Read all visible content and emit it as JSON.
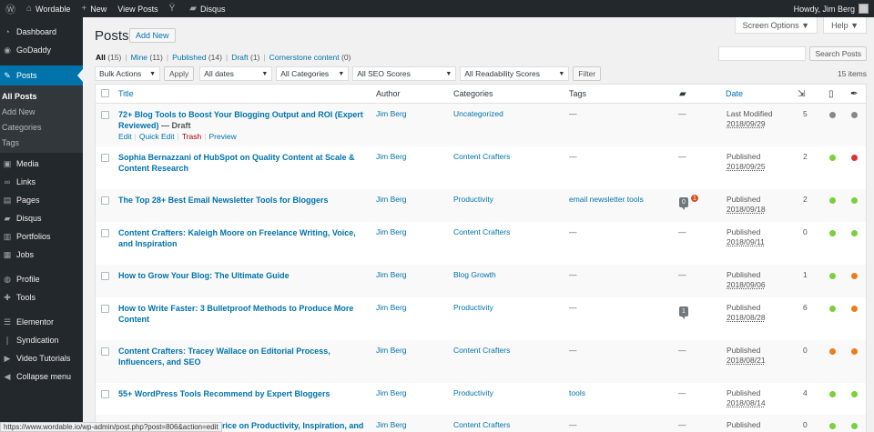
{
  "adminbar": {
    "site_name": "Wordable",
    "new_label": "New",
    "view_posts_label": "View Posts",
    "disqus_label": "Disqus",
    "howdy": "Howdy, Jim Berg"
  },
  "sidebar": {
    "items": [
      {
        "label": "Dashboard",
        "icon": "dashboard-icon",
        "glyph": "◔"
      },
      {
        "label": "GoDaddy",
        "icon": "godaddy-icon",
        "glyph": "◉"
      },
      {
        "label": "Posts",
        "icon": "pin-icon",
        "glyph": "✎"
      },
      {
        "label": "Media",
        "icon": "media-icon",
        "glyph": "▣"
      },
      {
        "label": "Links",
        "icon": "links-icon",
        "glyph": "∞"
      },
      {
        "label": "Pages",
        "icon": "pages-icon",
        "glyph": "▤"
      },
      {
        "label": "Disqus",
        "icon": "disqus-icon",
        "glyph": "▰"
      },
      {
        "label": "Portfolios",
        "icon": "portfolio-icon",
        "glyph": "▥"
      },
      {
        "label": "Jobs",
        "icon": "jobs-icon",
        "glyph": "▦"
      },
      {
        "label": "Profile",
        "icon": "profile-icon",
        "glyph": "◍"
      },
      {
        "label": "Tools",
        "icon": "tools-icon",
        "glyph": "✚"
      },
      {
        "label": "Elementor",
        "icon": "elementor-icon",
        "glyph": "☰"
      },
      {
        "label": "Syndication",
        "icon": "syndication-icon",
        "glyph": "❘"
      },
      {
        "label": "Video Tutorials",
        "icon": "video-icon",
        "glyph": "▶"
      },
      {
        "label": "Collapse menu",
        "icon": "collapse-icon",
        "glyph": "◀"
      }
    ],
    "submenu": [
      "All Posts",
      "Add New",
      "Categories",
      "Tags"
    ]
  },
  "screen_options": "Screen Options ▼",
  "help": "Help ▼",
  "page_title": "Posts",
  "add_new": "Add New",
  "filters": {
    "all": "All",
    "all_count": "(15)",
    "mine": "Mine",
    "mine_count": "(11)",
    "published": "Published",
    "published_count": "(14)",
    "draft": "Draft",
    "draft_count": "(1)",
    "cornerstone": "Cornerstone content",
    "cornerstone_count": "(0)"
  },
  "search_button": "Search Posts",
  "bulk_actions": "Bulk Actions",
  "apply": "Apply",
  "all_dates": "All dates",
  "all_categories": "All Categories",
  "all_seo": "All SEO Scores",
  "all_readability": "All Readability Scores",
  "filter": "Filter",
  "items_count": "15 items",
  "columns": {
    "title": "Title",
    "author": "Author",
    "categories": "Categories",
    "tags": "Tags",
    "date": "Date"
  },
  "row_actions": {
    "edit": "Edit",
    "quick_edit": "Quick Edit",
    "trash": "Trash",
    "preview": "Preview"
  },
  "colors": {
    "green": "#7ad03a",
    "red": "#dc3232",
    "orange": "#ee7c1b",
    "gray": "#888888"
  },
  "posts": [
    {
      "title": "72+ Blog Tools to Boost Your Blogging Output and ROI (Expert Reviewed)",
      "state": " — Draft",
      "author": "Jim Berg",
      "category": "Uncategorized",
      "tags": "—",
      "comments": "—",
      "date_status": "Last Modified",
      "date": "2018/09/29",
      "links": "5",
      "seo": "gray",
      "read": "gray"
    },
    {
      "title": "Sophia Bernazzani of HubSpot on Quality Content at Scale & Content Research",
      "state": "",
      "author": "Jim Berg",
      "category": "Content Crafters",
      "tags": "—",
      "comments": "—",
      "date_status": "Published",
      "date": "2018/09/25",
      "links": "2",
      "seo": "green",
      "read": "red"
    },
    {
      "title": "The Top 28+ Best Email Newsletter Tools for Bloggers",
      "state": "",
      "author": "Jim Berg",
      "category": "Productivity",
      "tags": "email newsletter tools",
      "comments": "",
      "comment_bubble": "0",
      "pending": "1",
      "date_status": "Published",
      "date": "2018/09/18",
      "links": "2",
      "seo": "green",
      "read": "green"
    },
    {
      "title": "Content Crafters: Kaleigh Moore on Freelance Writing, Voice, and Inspiration",
      "state": "",
      "author": "Jim Berg",
      "category": "Content Crafters",
      "tags": "—",
      "comments": "—",
      "date_status": "Published",
      "date": "2018/09/11",
      "links": "0",
      "seo": "green",
      "read": "green"
    },
    {
      "title": "How to Grow Your Blog: The Ultimate Guide",
      "state": "",
      "author": "Jim Berg",
      "category": "Blog Growth",
      "tags": "—",
      "comments": "—",
      "date_status": "Published",
      "date": "2018/09/06",
      "links": "1",
      "seo": "green",
      "read": "orange"
    },
    {
      "title": "How to Write Faster: 3 Bulletproof Methods to Produce More Content",
      "state": "",
      "author": "Jim Berg",
      "category": "Productivity",
      "tags": "—",
      "comments": "",
      "comment_bubble": "1",
      "date_status": "Published",
      "date": "2018/08/28",
      "links": "6",
      "seo": "green",
      "read": "orange"
    },
    {
      "title": "Content Crafters: Tracey Wallace on Editorial Process, Influencers, and SEO",
      "state": "",
      "author": "Jim Berg",
      "category": "Content Crafters",
      "tags": "—",
      "comments": "—",
      "date_status": "Published",
      "date": "2018/08/21",
      "links": "0",
      "seo": "orange",
      "read": "orange"
    },
    {
      "title": "55+ WordPress Tools Recommend by Expert Bloggers",
      "state": "",
      "author": "Jim Berg",
      "category": "Productivity",
      "tags": "tools",
      "comments": "—",
      "date_status": "Published",
      "date": "2018/08/14",
      "links": "4",
      "seo": "green",
      "read": "green"
    },
    {
      "title": "Content Crafters: Shayla Price on Productivity, Inspiration, and",
      "state": "",
      "author": "Jim Berg",
      "category": "Content Crafters",
      "tags": "—",
      "comments": "—",
      "date_status": "Published",
      "date": "",
      "links": "0",
      "seo": "green",
      "read": "green"
    }
  ],
  "status_url": "https://www.wordable.io/wp-admin/post.php?post=806&action=edit"
}
